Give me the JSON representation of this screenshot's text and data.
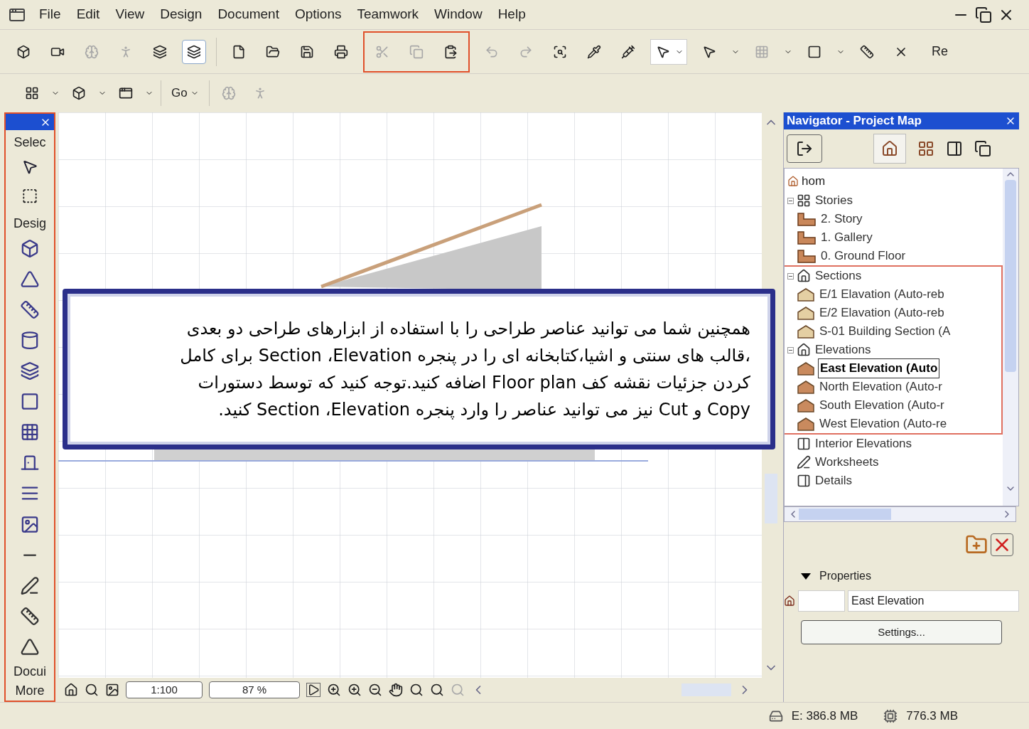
{
  "menu": [
    "File",
    "Edit",
    "View",
    "Design",
    "Document",
    "Options",
    "Teamwork",
    "Window",
    "Help"
  ],
  "toolbar": {
    "cut_off_label": "Re",
    "go_label": "Go"
  },
  "toolbox": {
    "sections": [
      "Selec",
      "Desig",
      "Docui",
      "More"
    ]
  },
  "overlay": {
    "lines": [
      "همچنین شما می توانید عناصر طراحی را با استفاده از ابزارهای طراحی دو بعدی",
      "،قالب های سنتی و اشیا،کتابخانه ای را در پنجره Section ،Elevation  برای کامل",
      "کردن جزئیات نقشه کف  Floor plan اضافه کنید.توجه کنید که توسط دستورات",
      "Copy و Cut نیز می توانید عناصر را وارد پنجره  Section ،Elevation کنید."
    ]
  },
  "navigator": {
    "title": "Navigator - Project Map",
    "tree": {
      "label": "hom",
      "kind": "project",
      "selected": false,
      "children": [
        {
          "label": "Stories",
          "kind": "story-group",
          "selected": false,
          "expanded": true,
          "highlighted": false,
          "children": [
            {
              "label": "2. Story",
              "kind": "story",
              "selected": false
            },
            {
              "label": "1. Gallery",
              "kind": "story",
              "selected": false
            },
            {
              "label": "0. Ground Floor",
              "kind": "story",
              "selected": false
            }
          ]
        },
        {
          "label": "Sections",
          "kind": "section-group",
          "selected": false,
          "expanded": true,
          "highlighted": true,
          "children": [
            {
              "label": "E/1 Elavation (Auto-reb",
              "kind": "section",
              "selected": false
            },
            {
              "label": "E/2 Elavation (Auto-reb",
              "kind": "section",
              "selected": false
            },
            {
              "label": "S-01 Building Section (A",
              "kind": "section",
              "selected": false
            }
          ]
        },
        {
          "label": "Elevations",
          "kind": "section-group",
          "selected": false,
          "expanded": true,
          "highlighted": true,
          "children": [
            {
              "label": "East Elevation (Auto",
              "kind": "elevation",
              "selected": true
            },
            {
              "label": "North Elevation (Auto-r",
              "kind": "elevation",
              "selected": false
            },
            {
              "label": "South Elevation (Auto-r",
              "kind": "elevation",
              "selected": false
            },
            {
              "label": "West Elevation (Auto-re",
              "kind": "elevation",
              "selected": false
            }
          ]
        },
        {
          "label": "Interior Elevations",
          "kind": "interior-group",
          "selected": false,
          "highlighted": false
        },
        {
          "label": "Worksheets",
          "kind": "worksheet-group",
          "selected": false,
          "highlighted": false
        },
        {
          "label": "Details",
          "kind": "detail-group",
          "selected": false,
          "highlighted": false
        }
      ]
    },
    "properties": {
      "title": "Properties",
      "expanded": true,
      "name_value": "East Elevation",
      "settings_button": "Settings..."
    }
  },
  "view_controls": {
    "scale": "1:100",
    "zoom": "87 %"
  },
  "status_bar": {
    "disk": "E: 386.8 MB",
    "memory": "776.3 MB"
  }
}
